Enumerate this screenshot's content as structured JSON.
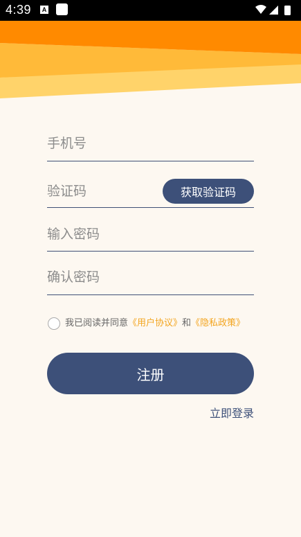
{
  "status_bar": {
    "time": "4:39",
    "app_indicator": "A"
  },
  "form": {
    "phone": {
      "placeholder": "手机号",
      "value": ""
    },
    "code": {
      "placeholder": "验证码",
      "value": "",
      "button_label": "获取验证码"
    },
    "password": {
      "placeholder": "输入密码",
      "value": ""
    },
    "confirm_password": {
      "placeholder": "确认密码",
      "value": ""
    }
  },
  "agreement": {
    "prefix": "我已阅读并同意",
    "user_agreement": "《用户协议》",
    "conjunction": "和",
    "privacy_policy": "《隐私政策》"
  },
  "actions": {
    "register_label": "注册",
    "login_label": "立即登录"
  },
  "theme": {
    "primary": "#3d5079",
    "accent": "#f3a51f",
    "background": "#fdf8f1",
    "orange_dark": "#ff8a00",
    "orange_mid": "#ffb838",
    "orange_light": "#ffd36a"
  }
}
